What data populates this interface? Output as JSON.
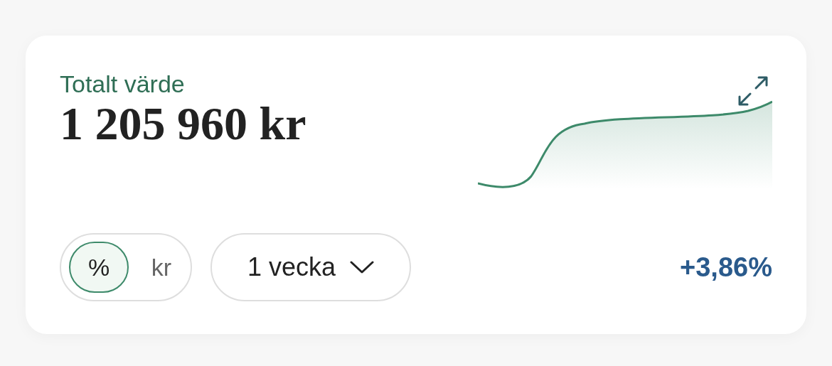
{
  "card": {
    "title": "Totalt värde",
    "value": "1 205 960 kr",
    "unit_toggle": [
      {
        "label": "%",
        "selected": true
      },
      {
        "label": "kr",
        "selected": false
      }
    ],
    "period_dropdown": {
      "label": "1 vecka"
    },
    "change": "+3,86%"
  }
}
